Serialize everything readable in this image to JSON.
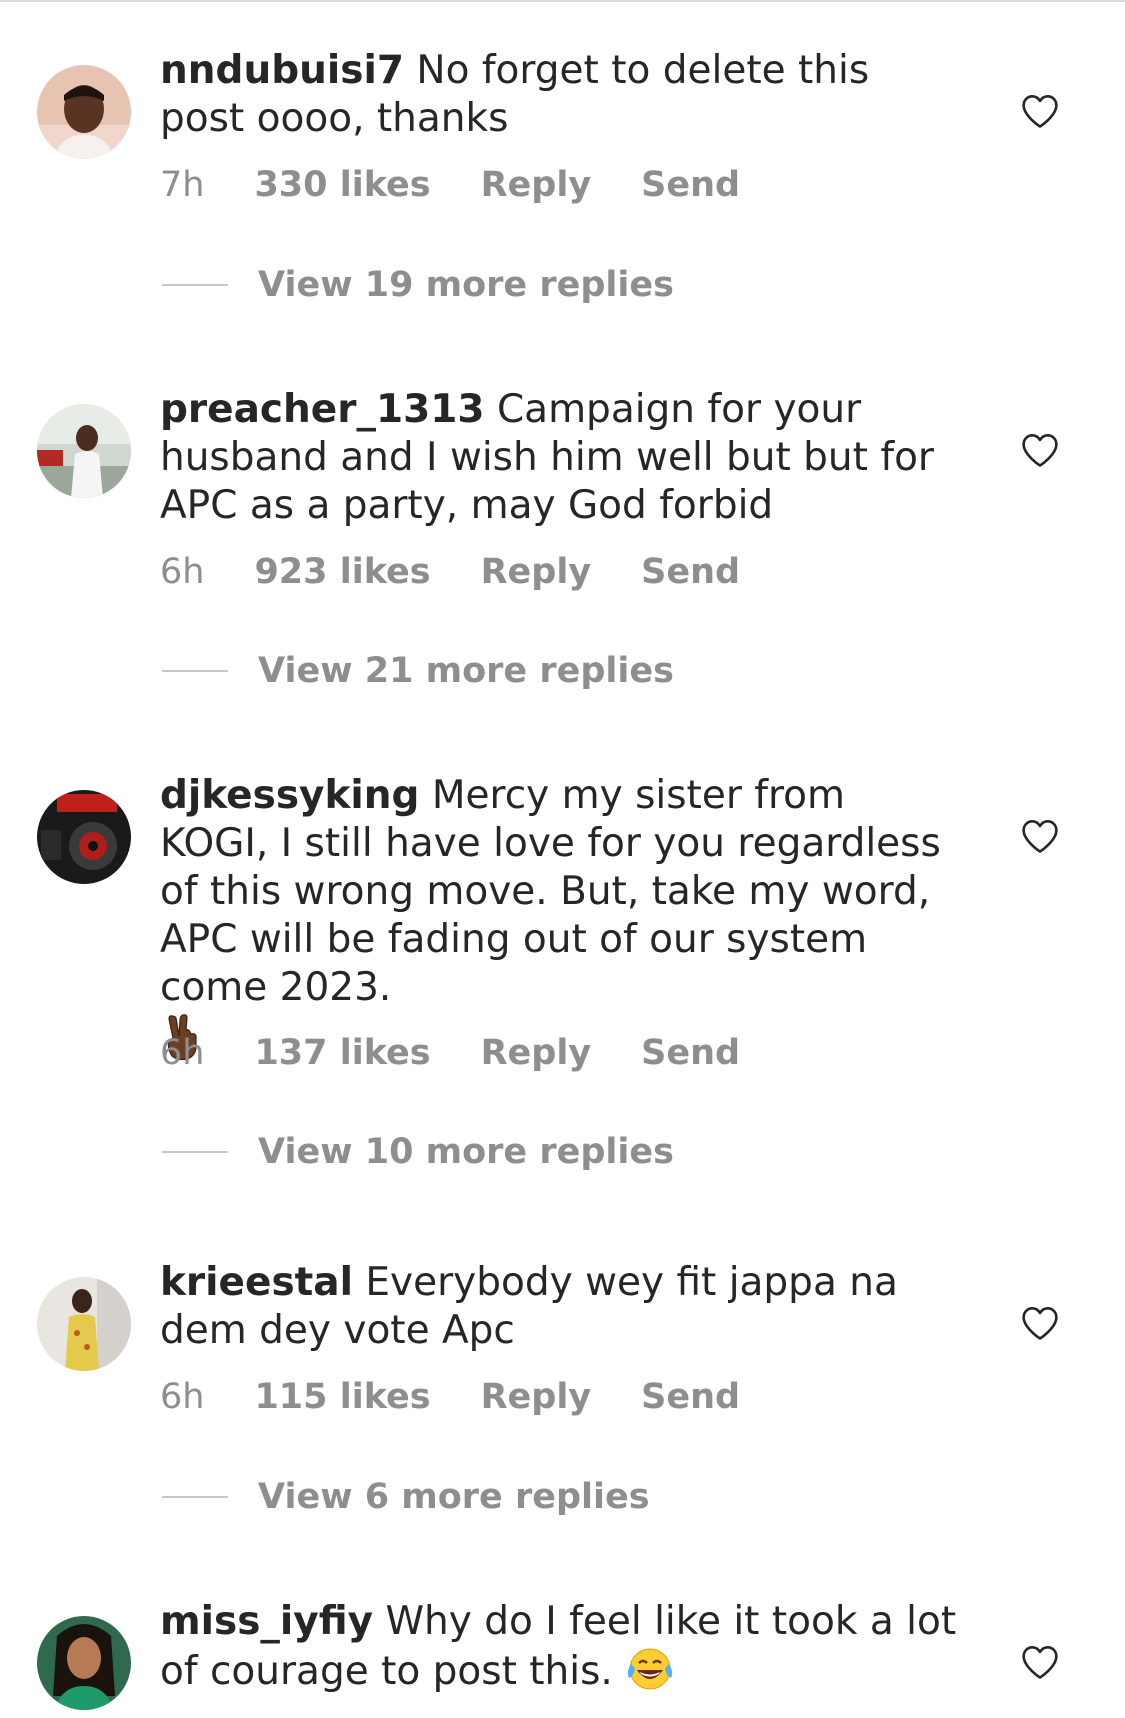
{
  "comments": [
    {
      "username": "nndubuisi7",
      "text": "No forget to delete this post oooo, thanks",
      "time": "7h",
      "likes": "330 likes",
      "reply": "Reply",
      "send": "Send",
      "view_replies": "View 19 more replies"
    },
    {
      "username": "preacher_1313",
      "text": "Campaign for your husband and I wish him well but but for APC as a party, may God forbid",
      "time": "6h",
      "likes": "923 likes",
      "reply": "Reply",
      "send": "Send",
      "view_replies": "View 21 more replies"
    },
    {
      "username": "djkessyking",
      "text": "Mercy my sister from KOGI, I still have love for you regardless of this wrong move. But, take my word, APC will be fading out of our system come 2023.",
      "emoji": "✌🏿",
      "time": "6h",
      "likes": "137 likes",
      "reply": "Reply",
      "send": "Send",
      "view_replies": "View 10 more replies"
    },
    {
      "username": "krieestal",
      "text": "Everybody wey fit jappa na dem dey vote Apc",
      "time": "6h",
      "likes": "115 likes",
      "reply": "Reply",
      "send": "Send",
      "view_replies": "View 6 more replies"
    },
    {
      "username": "miss_iyfiy",
      "text": "Why do I feel like it took a lot of courage to post this.",
      "emoji": "😂"
    }
  ]
}
